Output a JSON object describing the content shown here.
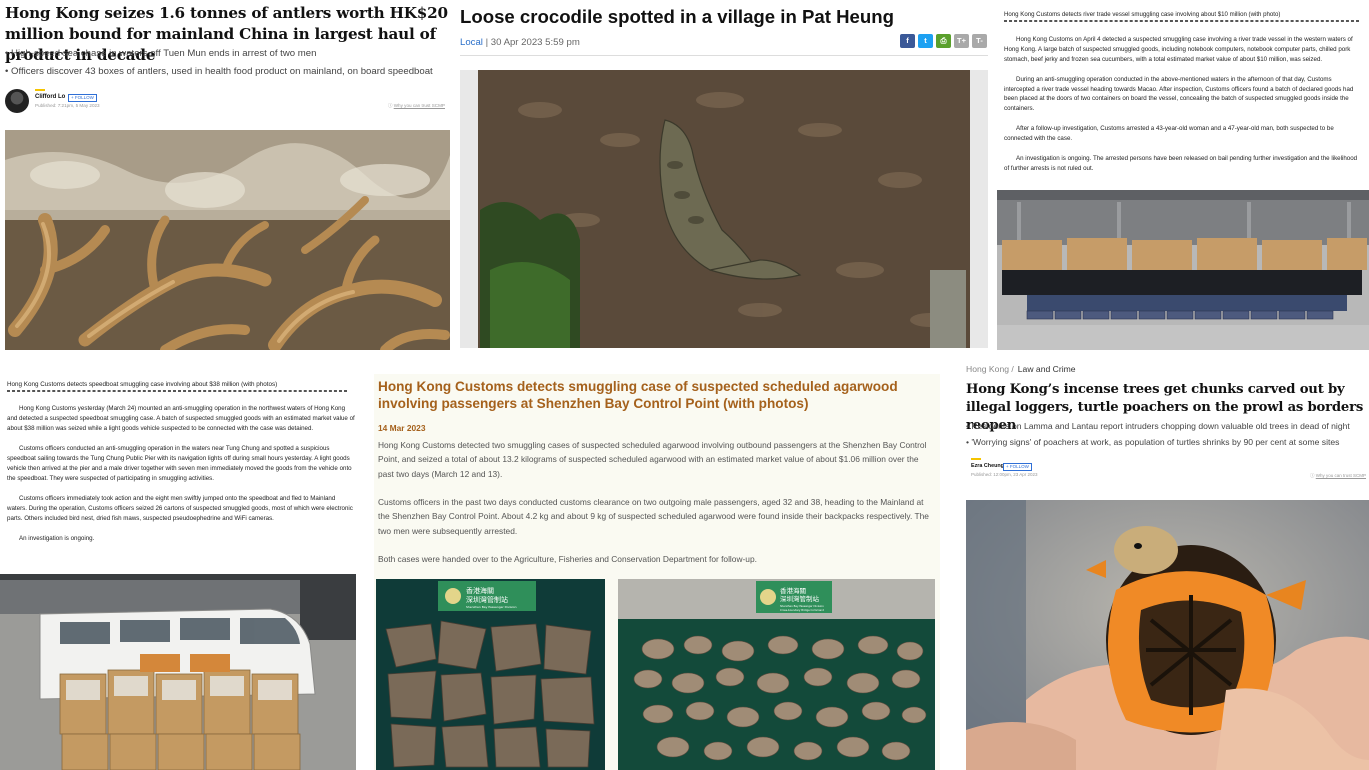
{
  "panel_antlers": {
    "headline": "Hong Kong seizes 1.6 tonnes of antlers worth HK$20 million bound for mainland China in largest haul of product in decade",
    "bullets": [
      "• High-speed sea chase in waters off Tuen Mun ends in arrest of two men",
      "• Officers discover 43 boxes of antlers, used in health food product on mainland, on board speedboat"
    ],
    "author": "Clifford Lo",
    "follow_label": "+ FOLLOW",
    "published": "Published: 7:21pm, 5 May 2023",
    "trust_link": "Why you can trust SCMP"
  },
  "panel_crocodile": {
    "headline": "Loose crocodile spotted in a village in Pat Heung",
    "section": "Local",
    "datetime": "| 30 Apr 2023 5:59 pm",
    "share_icons": [
      "facebook-icon",
      "twitter-icon",
      "print-icon",
      "text-larger-icon",
      "text-smaller-icon"
    ],
    "share_colors": [
      "#3b5998",
      "#1da1f2",
      "#5aa02c",
      "#a9a9a9",
      "#a9a9a9"
    ]
  },
  "panel_river_vessel": {
    "title": "Hong Kong Customs detects river trade vessel smuggling case involving about $10 million (with photo)",
    "paragraphs": [
      "Hong Kong Customs on April 4 detected a suspected smuggling case involving a river trade vessel in the western waters of Hong Kong. A large batch of suspected smuggled goods, including notebook computers, notebook computer parts, chilled pork stomach, beef jerky and frozen sea cucumbers, with a total estimated market value of about $10 million, was seized.",
      "During an anti-smuggling operation conducted in the above-mentioned waters in the afternoon of that day, Customs intercepted a river trade vessel heading towards Macao. After inspection, Customs officers found a batch of declared goods had been placed at the doors of two containers on board the vessel, concealing the batch of suspected smuggled goods inside the containers.",
      "After a follow-up investigation, Customs arrested a 43-year-old woman and a 47-year-old man, both suspected to be connected with the case.",
      "An investigation is ongoing. The arrested persons have been released on bail pending further investigation and the likelihood of further arrests is not ruled out."
    ]
  },
  "panel_speedboat": {
    "title": "Hong Kong Customs detects speedboat smuggling case involving about $38 million (with photos)",
    "paragraphs": [
      "Hong Kong Customs yesterday (March 24) mounted an anti-smuggling operation in the northwest waters of Hong Kong and detected a suspected speedboat smuggling case. A batch of suspected smuggled goods with an estimated market value of about $38 million was seized while a light goods vehicle suspected to be connected with the case was detained.",
      "Customs officers conducted an anti-smuggling operation in the waters near Tung Chung and spotted a suspicious speedboat sailing towards the Tung Chung Public Pier with its navigation lights off during small hours yesterday. A light goods vehicle then arrived at the pier and a male driver together with seven men immediately moved the goods from the vehicle onto the speedboat. They were suspected of participating in smuggling activities.",
      "Customs officers immediately took action and the eight men swiftly jumped onto the speedboat and fled to Mainland waters. During the operation, Customs officers seized 26 cartons of suspected smuggled goods, most of which were electronic parts. Others included bird nest, dried fish maws, suspected pseudoephedrine and WiFi cameras.",
      "An investigation is ongoing."
    ]
  },
  "panel_agarwood": {
    "headline": "Hong Kong Customs detects smuggling case of suspected scheduled agarwood involving passengers at Shenzhen Bay Control Point (with photos)",
    "date": "14 Mar 2023",
    "paragraphs": [
      "Hong Kong Customs detected two smuggling cases of suspected scheduled agarwood involving outbound passengers at the Shenzhen Bay Control Point, and seized a total of about 13.2 kilograms of suspected scheduled agarwood with an estimated market value of about $1.06 million over the past two days (March 12 and 13).",
      "Customs officers in the past two days conducted customs clearance on two outgoing male passengers, aged 32 and 38, heading to the Mainland at the Shenzhen Bay Control Point. About 4.2 kg and about 9 kg of suspected scheduled agarwood were found inside their backpacks respectively. The two men were subsequently arrested.",
      "Both cases were handed over to the Agriculture, Fisheries and Conservation Department for follow-up."
    ],
    "banner_line1": "香港海關",
    "banner_line2": "深圳灣管制站",
    "banner_line3": "Shenzhen Bay Passenger Division",
    "banner_line4": "Cross-boundary Bridge Command"
  },
  "panel_incense": {
    "breadcrumb_section": "Hong Kong /",
    "breadcrumb_sub": "Law and Crime",
    "headline": "Hong Kong’s incense trees get chunks carved out by illegal loggers, turtle poachers on the prowl as borders reopen",
    "bullets": [
      "• Residents on Lamma and Lantau report intruders chopping down valuable old trees in dead of night",
      "• 'Worrying signs' of poachers at work, as population of turtles shrinks by 90 per cent at some sites"
    ],
    "author": "Ezra Cheung",
    "follow_label": "+ FOLLOW",
    "published": "Published: 12:00pm, 23 Apr 2023",
    "trust_link": "Why you can trust SCMP"
  }
}
